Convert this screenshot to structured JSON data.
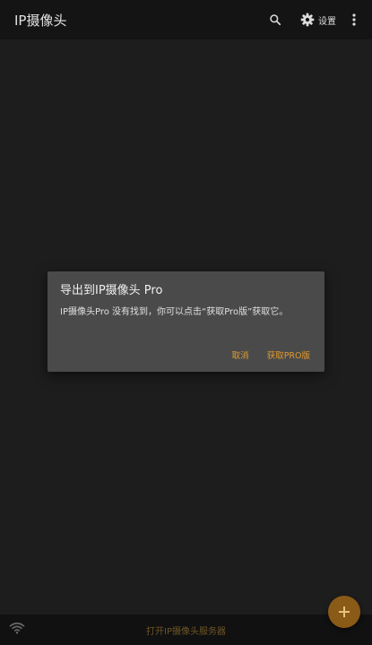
{
  "app_bar": {
    "title": "IP摄像头",
    "search_icon": "search-icon",
    "settings_icon": "gear-icon",
    "settings_label": "设置",
    "more_icon": "more-vert-icon"
  },
  "dialog": {
    "title": "导出到IP摄像头 Pro",
    "message": "IP摄像头Pro 没有找到，你可以点击“获取Pro版”获取它。",
    "cancel_label": "取消",
    "confirm_label": "获取PRO版",
    "accent_color": "#e29b2f"
  },
  "bottom_bar": {
    "wifi_icon": "wifi-icon",
    "label": "打开IP摄像头服务器"
  },
  "fab": {
    "icon": "plus-icon",
    "color": "#8a5a17"
  }
}
